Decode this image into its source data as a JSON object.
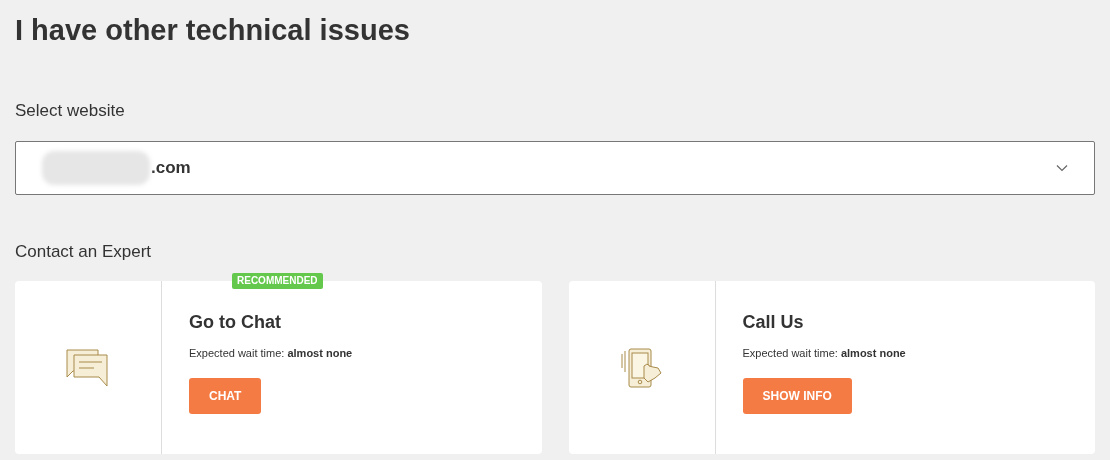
{
  "title": "I have other technical issues",
  "website_select": {
    "label": "Select website",
    "value": ".com",
    "redacted": true
  },
  "contact": {
    "heading": "Contact an Expert",
    "options": [
      {
        "kind": "chat",
        "title": "Go to Chat",
        "badge": "RECOMMENDED",
        "wait": "Expected wait time: **almost none**",
        "button": "CHAT"
      },
      {
        "kind": "call",
        "title": "Call Us",
        "wait": "Expected wait time: **almost none**",
        "button": "SHOW INFO"
      }
    ]
  }
}
